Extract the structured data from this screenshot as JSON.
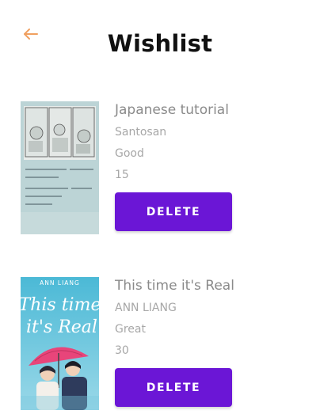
{
  "header": {
    "title": "Wishlist",
    "back_icon": "arrow-left-icon",
    "accent_color": "#f0a060"
  },
  "wishlist": [
    {
      "title": "Japanese tutorial",
      "author": "Santosan",
      "condition": "Good",
      "price": "15",
      "delete_label": "DELETE"
    },
    {
      "title": "This time it's Real",
      "author": "ANN LIANG",
      "condition": "Great",
      "price": "30",
      "delete_label": "DELETE",
      "cover": {
        "author_text": "ANN LIANG",
        "title_text_1": "This time",
        "title_text_2": "it's Real"
      }
    }
  ],
  "colors": {
    "delete_button": "#6b16d6",
    "title_text": "#111111",
    "secondary_text": "#a7a7a7"
  }
}
